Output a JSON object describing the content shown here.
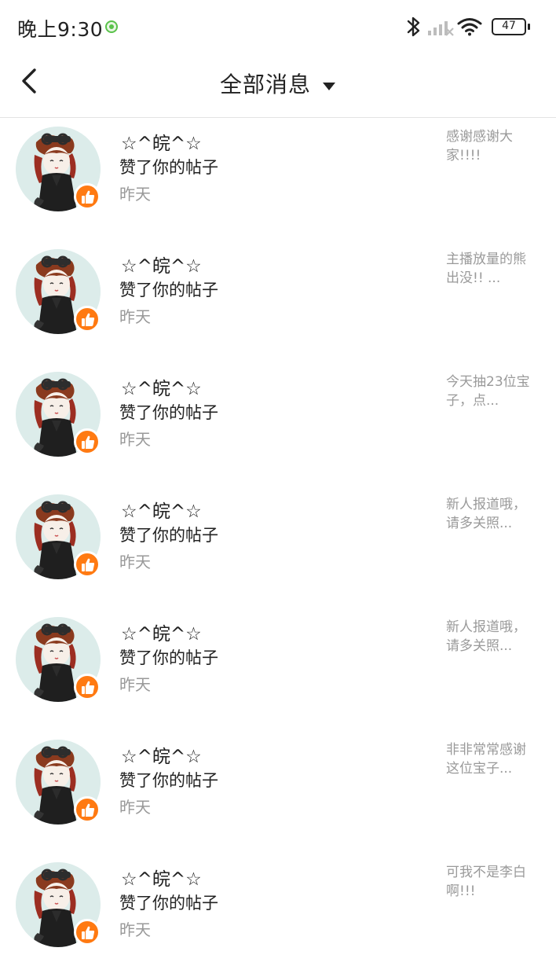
{
  "status_bar": {
    "time": "晚上9:30",
    "battery": "47"
  },
  "nav": {
    "title": "全部消息"
  },
  "colors": {
    "accent": "#ff7a12",
    "text_primary": "#222222",
    "text_secondary": "#999999"
  },
  "icons": {
    "back": "chevron-left-icon",
    "dropdown": "caret-down-icon",
    "like": "thumbs-up-icon"
  },
  "messages": [
    {
      "name": "☆^皖^☆",
      "action": "赞了你的帖子",
      "time": "昨天",
      "preview": "感谢感谢大家!!!!"
    },
    {
      "name": "☆^皖^☆",
      "action": "赞了你的帖子",
      "time": "昨天",
      "preview": "主播放量的熊出没!! ..."
    },
    {
      "name": "☆^皖^☆",
      "action": "赞了你的帖子",
      "time": "昨天",
      "preview": "今天抽23位宝子，点..."
    },
    {
      "name": "☆^皖^☆",
      "action": "赞了你的帖子",
      "time": "昨天",
      "preview": "新人报道哦，请多关照..."
    },
    {
      "name": "☆^皖^☆",
      "action": "赞了你的帖子",
      "time": "昨天",
      "preview": "新人报道哦，请多关照..."
    },
    {
      "name": "☆^皖^☆",
      "action": "赞了你的帖子",
      "time": "昨天",
      "preview": "非非常常感谢这位宝子..."
    },
    {
      "name": "☆^皖^☆",
      "action": "赞了你的帖子",
      "time": "昨天",
      "preview": "可我不是李白啊!!!"
    }
  ]
}
